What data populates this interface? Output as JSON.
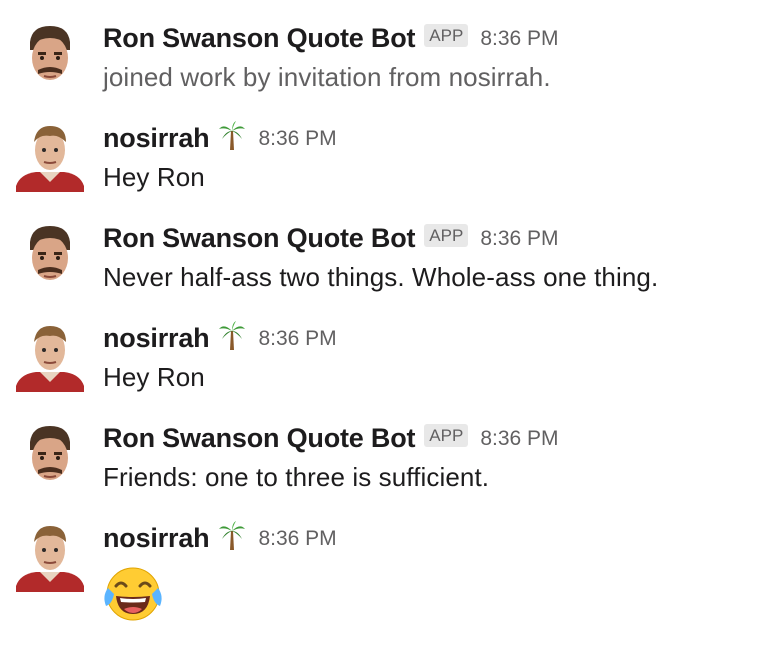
{
  "messages": [
    {
      "sender": "Ron Swanson Quote Bot",
      "badge": "APP",
      "time": "8:36 PM",
      "text": "joined work by invitation from nosirrah.",
      "avatar": "ron-swanson-avatar"
    },
    {
      "sender": "nosirrah",
      "status_emoji": "palm-tree-icon",
      "time": "8:36 PM",
      "text": "Hey Ron",
      "avatar": "nosirrah-avatar"
    },
    {
      "sender": "Ron Swanson Quote Bot",
      "badge": "APP",
      "time": "8:36 PM",
      "text": "Never half-ass two things. Whole-ass one thing.",
      "avatar": "ron-swanson-avatar"
    },
    {
      "sender": "nosirrah",
      "status_emoji": "palm-tree-icon",
      "time": "8:36 PM",
      "text": "Hey Ron",
      "avatar": "nosirrah-avatar"
    },
    {
      "sender": "Ron Swanson Quote Bot",
      "badge": "APP",
      "time": "8:36 PM",
      "text": "Friends: one to three is sufficient.",
      "avatar": "ron-swanson-avatar"
    },
    {
      "sender": "nosirrah",
      "status_emoji": "palm-tree-icon",
      "time": "8:36 PM",
      "reaction_emoji": "laughing-with-tears-emoji",
      "avatar": "nosirrah-avatar"
    }
  ],
  "colors": {
    "text": "#1d1c1d",
    "muted": "#616061",
    "badge_bg": "#e8e8e8"
  }
}
